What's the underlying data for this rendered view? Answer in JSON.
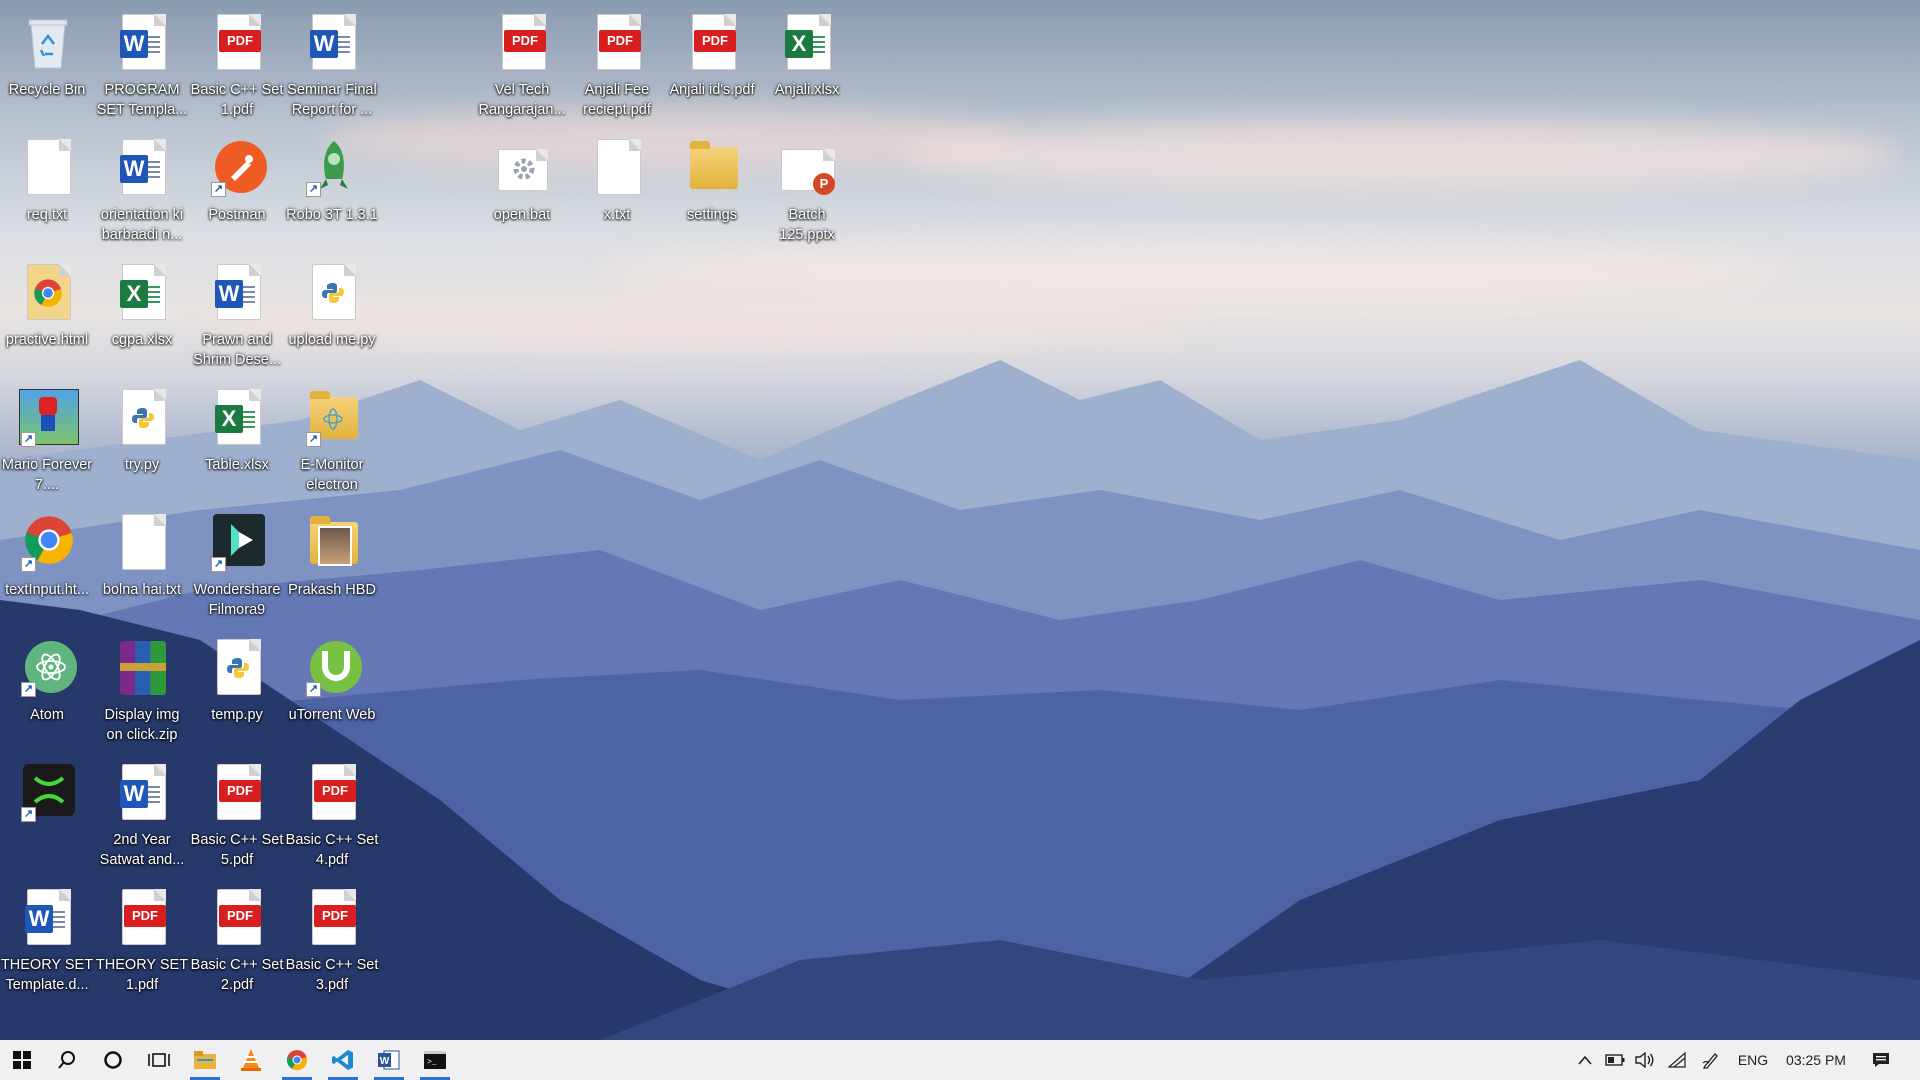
{
  "desktop": {
    "icons": [
      {
        "id": "recycle-bin",
        "label": "Recycle Bin",
        "type": "recycle"
      },
      {
        "id": "program-set-template",
        "label": "PROGRAM SET Templa...",
        "type": "word"
      },
      {
        "id": "basic-cpp-set1",
        "label": "Basic C++ Set 1.pdf",
        "type": "pdf"
      },
      {
        "id": "seminar-final-report",
        "label": "Seminar Final Report for ...",
        "type": "word"
      },
      {
        "id": "vel-tech",
        "label": "Vel Tech Rangarajan...",
        "type": "pdf"
      },
      {
        "id": "anjali-fee-receipt",
        "label": "Anjali Fee reciept.pdf",
        "type": "pdf"
      },
      {
        "id": "anjali-ids",
        "label": "Anjali id's.pdf",
        "type": "pdf"
      },
      {
        "id": "anjali-xlsx",
        "label": "Anjali.xlsx",
        "type": "excel"
      },
      {
        "id": "req-txt",
        "label": "req.txt",
        "type": "txt"
      },
      {
        "id": "orientation",
        "label": "orientation ki barbaadi n...",
        "type": "word"
      },
      {
        "id": "postman",
        "label": "Postman",
        "type": "postman"
      },
      {
        "id": "robo3t",
        "label": "Robo 3T 1.3.1",
        "type": "robo"
      },
      {
        "id": "open-bat",
        "label": "open.bat",
        "type": "bat"
      },
      {
        "id": "x-txt",
        "label": "x.txt",
        "type": "txt"
      },
      {
        "id": "settings",
        "label": "settings",
        "type": "folder"
      },
      {
        "id": "batch125",
        "label": "Batch 125.pptx",
        "type": "pptx"
      },
      {
        "id": "practice-html",
        "label": "practive.html",
        "type": "chrome-html"
      },
      {
        "id": "cgpa-xlsx",
        "label": "cgpa.xlsx",
        "type": "excel"
      },
      {
        "id": "prawn-shrimp",
        "label": "Prawn and Shrim Dese...",
        "type": "word"
      },
      {
        "id": "upload-me-py",
        "label": "upload me.py",
        "type": "python"
      },
      {
        "id": "mario",
        "label": "Mario Forever 7....",
        "type": "mario"
      },
      {
        "id": "try-py",
        "label": "try.py",
        "type": "python"
      },
      {
        "id": "table-xlsx",
        "label": "Table.xlsx",
        "type": "excel"
      },
      {
        "id": "e-monitor",
        "label": "E-Monitor electron",
        "type": "folder-app"
      },
      {
        "id": "textinput",
        "label": "textInput.ht...",
        "type": "chrome"
      },
      {
        "id": "bolna-hai",
        "label": "bolna hai.txt",
        "type": "txt"
      },
      {
        "id": "filmora",
        "label": "Wondershare Filmora9",
        "type": "filmora"
      },
      {
        "id": "prakash-hbd",
        "label": "Prakash HBD",
        "type": "photo"
      },
      {
        "id": "atom",
        "label": "Atom",
        "type": "atom"
      },
      {
        "id": "display-img-zip",
        "label": "Display img on click.zip",
        "type": "zip"
      },
      {
        "id": "temp-py",
        "label": "temp.py",
        "type": "python"
      },
      {
        "id": "utorrent",
        "label": "uTorrent Web",
        "type": "utorrent"
      },
      {
        "id": "xampp",
        "label": "",
        "type": "xampp"
      },
      {
        "id": "second-year",
        "label": "2nd Year Satwat and...",
        "type": "word"
      },
      {
        "id": "basic-cpp-set5",
        "label": "Basic C++ Set 5.pdf",
        "type": "pdf"
      },
      {
        "id": "basic-cpp-set4",
        "label": "Basic C++ Set 4.pdf",
        "type": "pdf"
      },
      {
        "id": "theory-set-template",
        "label": "THEORY SET Template.d...",
        "type": "word"
      },
      {
        "id": "theory-set1",
        "label": "THEORY SET 1.pdf",
        "type": "pdf"
      },
      {
        "id": "basic-cpp-set2",
        "label": "Basic C++ Set 2.pdf",
        "type": "pdf"
      },
      {
        "id": "basic-cpp-set3",
        "label": "Basic C++ Set 3.pdf",
        "type": "pdf"
      }
    ],
    "badge_text": {
      "pdf": "PDF",
      "word": "W",
      "excel": "X",
      "pptx": "P"
    }
  },
  "taskbar": {
    "items": [
      {
        "id": "start",
        "icon": "windows-start-icon"
      },
      {
        "id": "search",
        "icon": "search-icon"
      },
      {
        "id": "cortana",
        "icon": "cortana-icon"
      },
      {
        "id": "task-view",
        "icon": "task-view-icon"
      },
      {
        "id": "file-explorer",
        "icon": "file-explorer-icon",
        "active": true
      },
      {
        "id": "vlc",
        "icon": "vlc-icon"
      },
      {
        "id": "chrome",
        "icon": "chrome-icon",
        "active": true
      },
      {
        "id": "vscode",
        "icon": "vscode-icon",
        "active": true
      },
      {
        "id": "word",
        "icon": "word-icon",
        "active": true
      },
      {
        "id": "terminal",
        "icon": "terminal-icon",
        "active": true
      }
    ],
    "tray": {
      "language": "ENG",
      "time": "03:25 PM",
      "icons": [
        "chevron-up-icon",
        "battery-icon",
        "volume-icon",
        "wifi-icon",
        "pen-icon",
        "notification-icon"
      ]
    }
  },
  "colors": {
    "taskbar_bg": "#f0f0f2",
    "active_indicator": "#2a72d6"
  }
}
